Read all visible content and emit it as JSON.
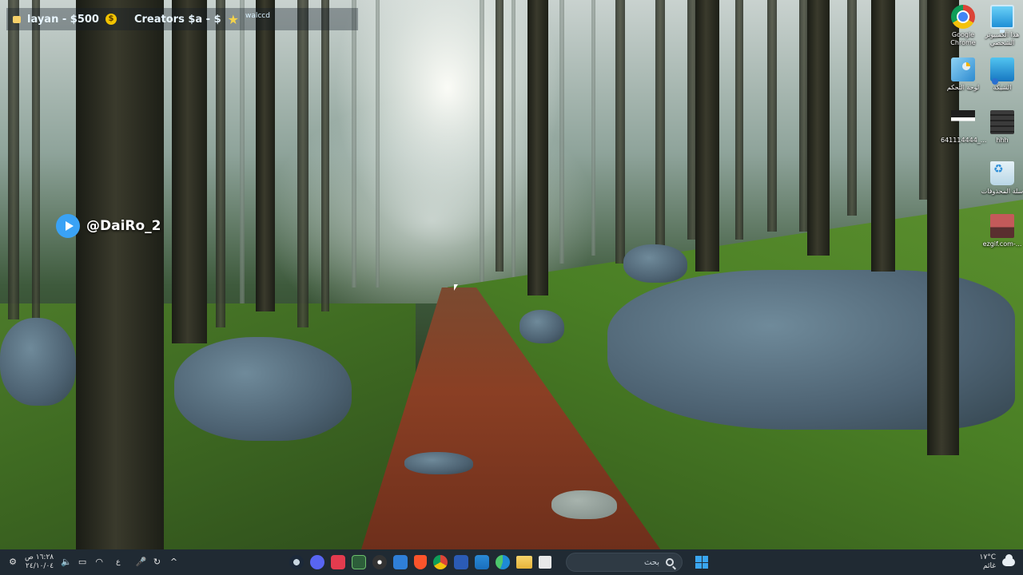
{
  "overlay": {
    "ticker_left": "layan - $500",
    "ticker_right": "Creators $a - $",
    "ticker_small": "walccd",
    "handle": "@DaiRo_2"
  },
  "desktop_icons": [
    {
      "label": "Google Chrome",
      "icon": "chrome-icon"
    },
    {
      "label": "هذا الكمبيوتر الشخصي",
      "icon": "computer-icon"
    },
    {
      "label": "لوحة التحكم",
      "icon": "control-panel-icon"
    },
    {
      "label": "الشبكة",
      "icon": "network-icon"
    },
    {
      "label": "641114444_...",
      "icon": "file-icon"
    },
    {
      "label": "hhh",
      "icon": "file-icon"
    },
    {
      "label": "سلة المحذوفات",
      "icon": "recycle-bin-icon"
    },
    {
      "label": "ezgif.com-...",
      "icon": "gif-file-icon"
    }
  ],
  "taskbar": {
    "clock_time": "١٦:٢٨ ص",
    "clock_date": "٢٤/١٠/٠٤",
    "lang": "ع",
    "search_placeholder": "بحث",
    "weather_temp": "١٧°C",
    "weather_condition": "غائم",
    "apps": [
      "steam",
      "discord",
      "r",
      "xbox",
      "obs",
      "mail",
      "brave",
      "chrome",
      "word",
      "store",
      "edge",
      "folder",
      "notes"
    ]
  }
}
